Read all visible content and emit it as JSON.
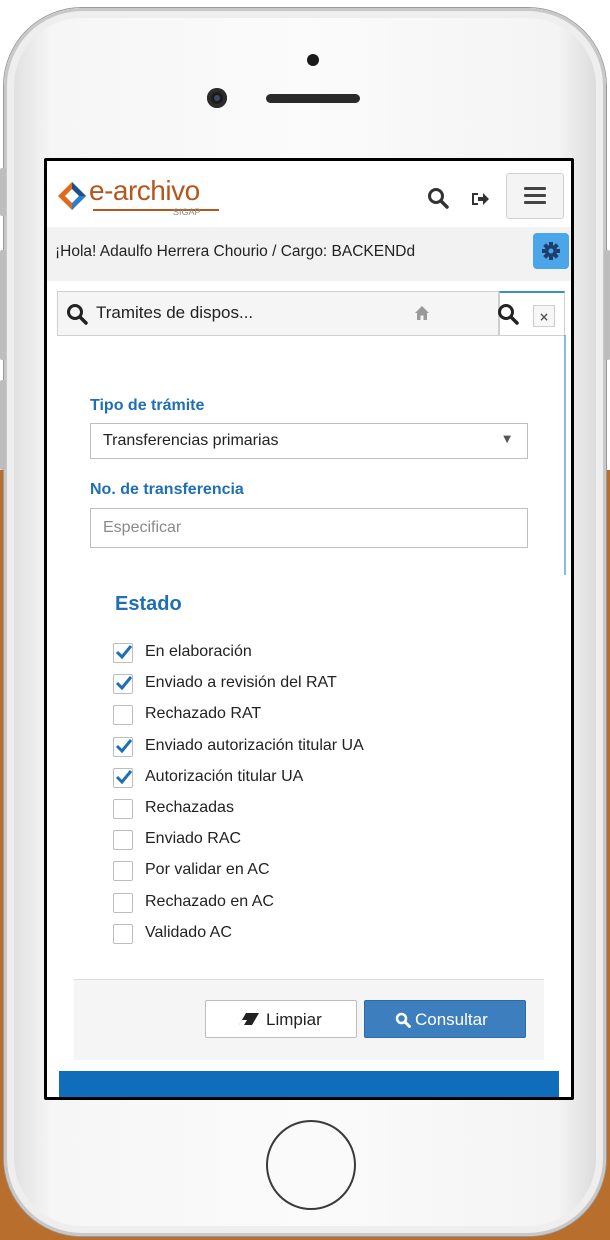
{
  "header": {
    "logo_text": "e-archivo",
    "logo_sub": "SIGAP",
    "icons": [
      "search-icon",
      "logout-icon",
      "hamburger-menu-icon"
    ]
  },
  "greeting": {
    "text": "¡Hola! Adaulfo Herrera Chourio / Cargo: BACKENDd",
    "settings_icon": "gear-icon"
  },
  "tabs": {
    "active_title": "Tramites de dispos...",
    "icons": [
      "search-icon",
      "home-icon",
      "search-icon",
      "close-icon"
    ],
    "close_label": "×"
  },
  "form": {
    "tipo_label": "Tipo de trámite",
    "tipo_value": "Transferencias primarias",
    "transferencia_label": "No. de transferencia",
    "transferencia_placeholder": "Especificar",
    "estado_label": "Estado",
    "estados": [
      {
        "label": "En elaboración",
        "checked": true
      },
      {
        "label": "Enviado a revisión del RAT",
        "checked": true
      },
      {
        "label": "Rechazado RAT",
        "checked": false
      },
      {
        "label": "Enviado autorización titular UA",
        "checked": true
      },
      {
        "label": "Autorización titular UA",
        "checked": true
      },
      {
        "label": "Rechazadas",
        "checked": false
      },
      {
        "label": "Enviado RAC",
        "checked": false
      },
      {
        "label": "Por validar en AC",
        "checked": false
      },
      {
        "label": "Rechazado en AC",
        "checked": false
      },
      {
        "label": "Validado AC",
        "checked": false
      }
    ]
  },
  "actions": {
    "clear_label": "Limpiar",
    "query_label": "Consultar"
  },
  "colors": {
    "accent": "#1f6fb5",
    "primary_button": "#3d7ebf",
    "logo": "#b5561f",
    "gear_button": "#4aa6e8",
    "bottom_bar": "#0f6dbb",
    "background_lower": "#b86e2c"
  }
}
